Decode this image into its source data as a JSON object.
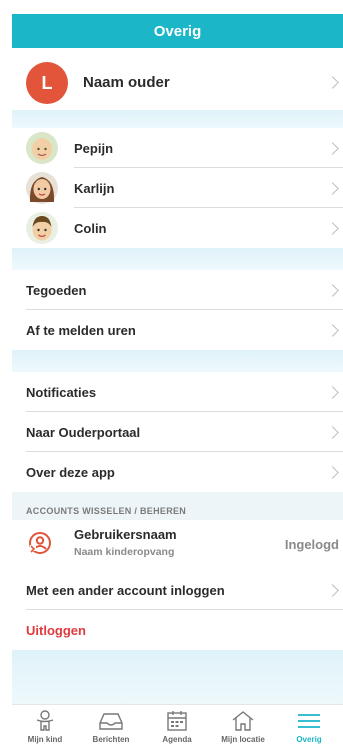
{
  "header": {
    "title": "Overig"
  },
  "profile": {
    "initial": "L",
    "name": "Naam ouder"
  },
  "children": [
    {
      "name": "Pepijn"
    },
    {
      "name": "Karlijn"
    },
    {
      "name": "Colin"
    }
  ],
  "menu1": [
    {
      "label": "Tegoeden"
    },
    {
      "label": "Af te melden uren"
    }
  ],
  "menu2": [
    {
      "label": "Notificaties"
    },
    {
      "label": "Naar Ouderportaal"
    },
    {
      "label": "Over deze app"
    }
  ],
  "accounts": {
    "section_title": "ACCOUNTS WISSELEN / BEHEREN",
    "username": "Gebruikersnaam",
    "org": "Naam kinderopvang",
    "status": "Ingelogd",
    "other_account": "Met een ander account inloggen",
    "logout": "Uitloggen"
  },
  "tabs": [
    {
      "label": "Mijn kind",
      "icon": "child-icon"
    },
    {
      "label": "Berichten",
      "icon": "inbox-icon"
    },
    {
      "label": "Agenda",
      "icon": "calendar-icon"
    },
    {
      "label": "Mijn locatie",
      "icon": "home-icon"
    },
    {
      "label": "Overig",
      "icon": "menu-icon",
      "active": true
    }
  ],
  "colors": {
    "accent": "#1bb6c8",
    "avatar": "#e2553a",
    "logout": "#e03a3f"
  }
}
